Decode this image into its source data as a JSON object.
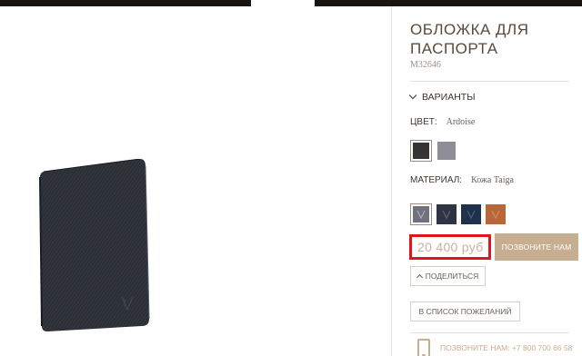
{
  "product": {
    "title": "ОБЛОЖКА ДЛЯ ПАСПОРТА",
    "sku": "M32646"
  },
  "variants": {
    "heading": "ВАРИАНТЫ",
    "color_label": "ЦВЕТ:",
    "color_value": "Ardoise",
    "color_swatches": [
      {
        "name": "Ardoise",
        "hex": "#353535",
        "selected": true
      },
      {
        "name": "grey",
        "hex": "#8e8d98",
        "selected": false
      }
    ],
    "material_label": "МАТЕРИАЛ:",
    "material_value": "Кожа Taiga",
    "material_swatches": [
      {
        "hex": "#6f717d",
        "selected": true
      },
      {
        "hex": "#2e3443",
        "selected": false
      },
      {
        "hex": "#20314d",
        "selected": false
      },
      {
        "hex": "#b8673a",
        "selected": false
      }
    ]
  },
  "purchase": {
    "price": "20 400 руб",
    "call_button": "ПОЗВОНИТЕ НАМ",
    "share_button": "ПОДЕЛИТЬСЯ",
    "wishlist_button": "В СПИСОК ПОЖЕЛАНИЙ"
  },
  "contact": {
    "text": "ПОЗВОНИТЕ НАМ: +7 800 700 66 58"
  },
  "colors": {
    "accent": "#c8ae90",
    "highlight_border": "#e0161f",
    "text": "#5b4a3d"
  }
}
